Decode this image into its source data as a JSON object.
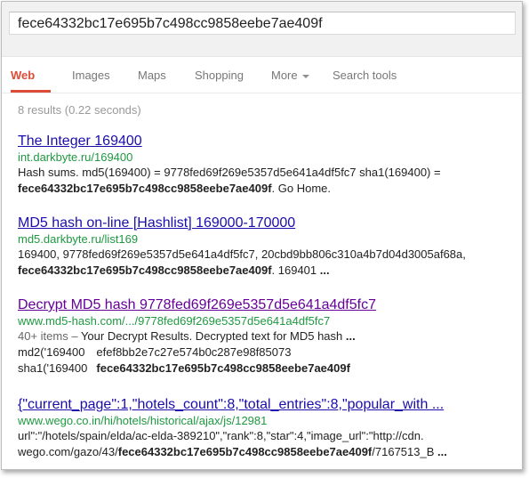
{
  "search": {
    "query": "fece64332bc17e695b7c498cc9858eebe7ae409f"
  },
  "tabs": [
    {
      "label": "Web"
    },
    {
      "label": "Images"
    },
    {
      "label": "Maps"
    },
    {
      "label": "Shopping"
    },
    {
      "label": "More"
    },
    {
      "label": "Search tools"
    }
  ],
  "stats": "8 results (0.22 seconds)",
  "colors": {
    "accent": "#dd4b39",
    "link": "#1a0dab",
    "visited": "#660099",
    "url": "#1e9940"
  },
  "results": [
    {
      "title": "The Integer 169400",
      "url": "int.darkbyte.ru/169400",
      "lines": [
        [
          {
            "t": "Hash sums. md5(169400) = 9778fed69f269e5357d5e641a4df5fc7 sha1(169400) ="
          }
        ],
        [
          {
            "t": "fece64332bc17e695b7c498cc9858eebe7ae409f",
            "b": true
          },
          {
            "t": ". Go Home."
          }
        ]
      ]
    },
    {
      "title": "MD5 hash on-line [Hashlist] 169000-170000",
      "url": "md5.darkbyte.ru/list169",
      "lines": [
        [
          {
            "t": "169400, 9778fed69f269e5357d5e641a4df5fc7, 20cbd9bb806c310a4b7d04d3005af68a,"
          }
        ],
        [
          {
            "t": "fece64332bc17e695b7c498cc9858eebe7ae409f",
            "b": true
          },
          {
            "t": ". 169401 "
          },
          {
            "t": "...",
            "b": true
          }
        ]
      ]
    },
    {
      "title": "Decrypt MD5 hash 9778fed69f269e5357d5e641a4df5fc7",
      "url": "www.md5-hash.com/.../9778fed69f269e5357d5e641a4df5fc7",
      "lines": [
        [
          {
            "t": "40+ items – ",
            "g": true
          },
          {
            "t": "Your Decrypt Results. Decrypted text for MD5 hash "
          },
          {
            "t": "...",
            "b": true
          }
        ]
      ],
      "table": [
        [
          "md2('169400",
          "efef8bb2e7c27e574b0c287e98f85073"
        ],
        [
          "sha1('169400",
          "fece64332bc17e695b7c498cc9858eebe7ae409f"
        ]
      ]
    },
    {
      "title": "{\"current_page\":1,\"hotels_count\":8,\"total_entries\":8,\"popular_with ...",
      "url": "www.wego.co.in/hi/hotels/historical/ajax/js/12981",
      "lines": [
        [
          {
            "t": "url\":\"/hotels/spain/elda/ac-elda-389210\",\"rank\":8,\"star\":4,\"image_url\":\"http://cdn."
          }
        ],
        [
          {
            "t": "wego.com/gazo/43/"
          },
          {
            "t": "fece64332bc17e695b7c498cc9858eebe7ae409f",
            "b": true
          },
          {
            "t": "/7167513_B "
          },
          {
            "t": "...",
            "b": true
          }
        ]
      ]
    }
  ]
}
